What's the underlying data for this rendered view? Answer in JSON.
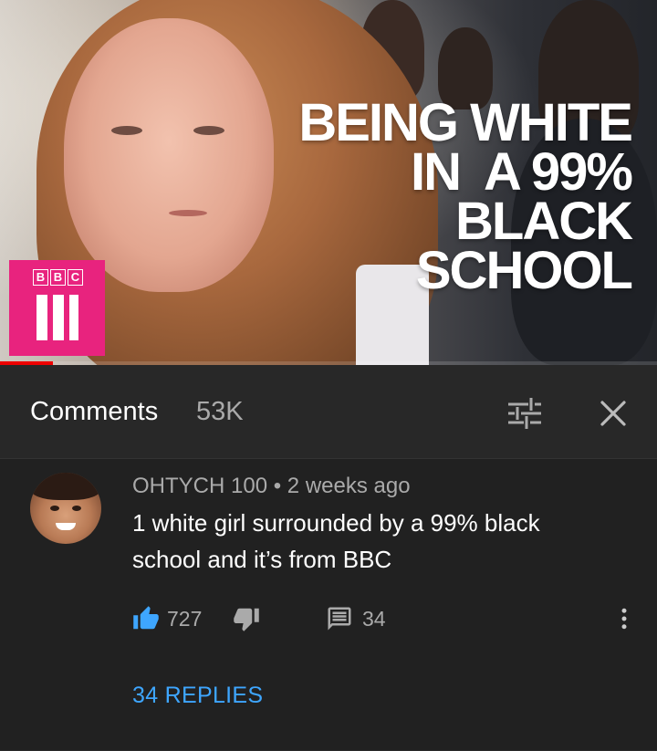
{
  "video": {
    "title_lines": [
      "BEING WHITE",
      "IN  A 99%",
      "BLACK SCHOOL"
    ],
    "channel_logo_letters": [
      "B",
      "B",
      "C"
    ],
    "progress_fraction": 0.08
  },
  "comments_header": {
    "title": "Comments",
    "count": "53K",
    "sort_icon": "sort-sliders-icon",
    "close_icon": "close-icon"
  },
  "comment": {
    "author": "OHTYCH 100",
    "separator": "•",
    "time": "2 weeks ago",
    "text": "1 white girl surrounded by a 99% black school and it’s from BBC",
    "likes": "727",
    "reply_count": "34",
    "replies_label": "34 REPLIES"
  },
  "colors": {
    "background": "#212121",
    "header_background": "#282828",
    "like_active": "#3ea6ff",
    "replies_link": "#3ea6ff",
    "logo_pink": "#e8237e"
  }
}
